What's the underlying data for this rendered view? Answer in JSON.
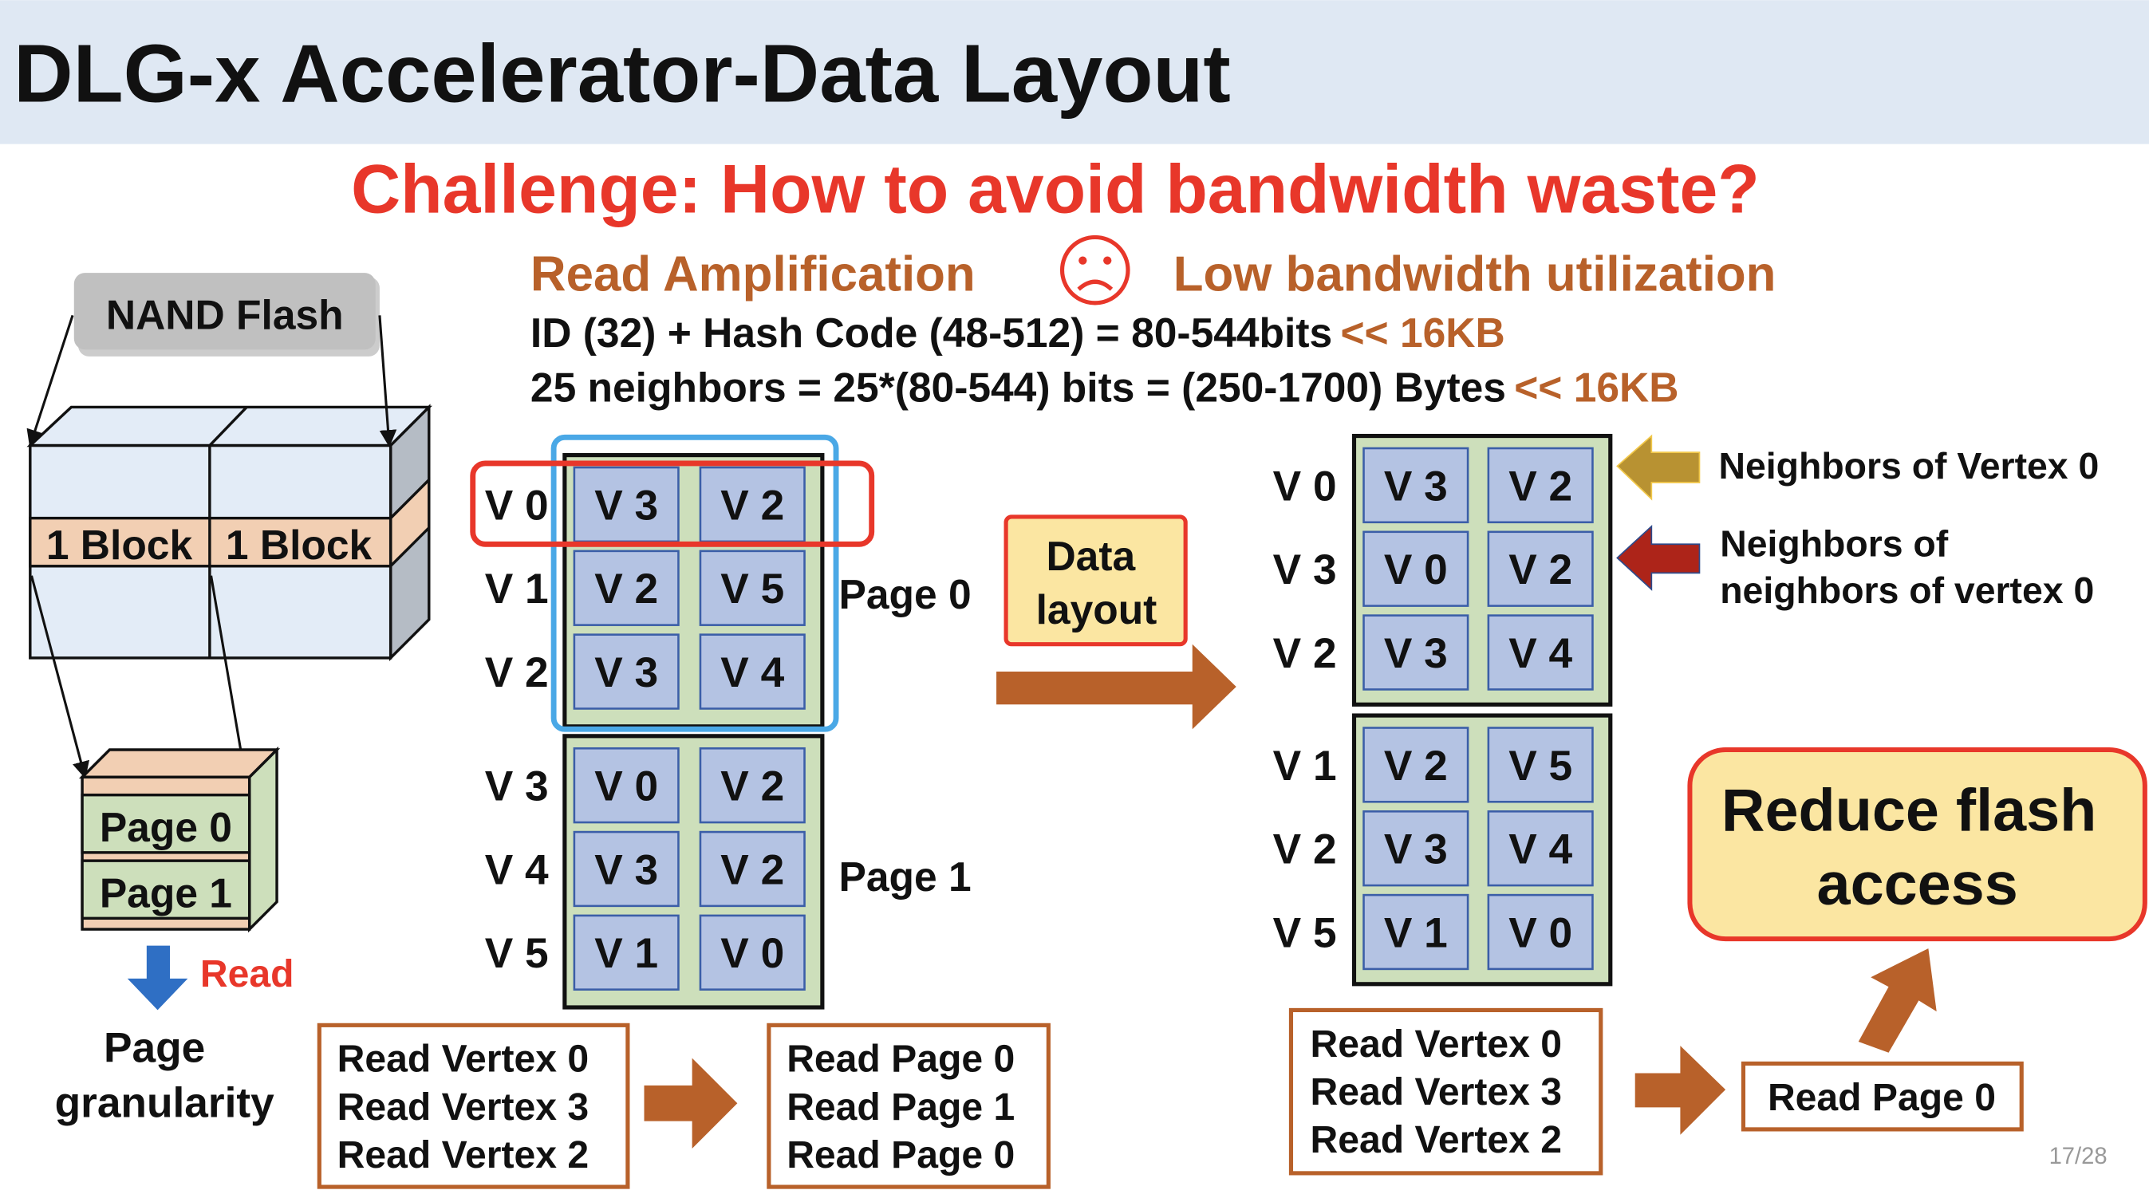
{
  "title": "DLG-x Accelerator-Data Layout",
  "challenge": "Challenge: How to avoid bandwidth waste?",
  "problem": {
    "read_amplification": "Read Amplification",
    "sad_face_icon": "sad-face",
    "low_bandwidth": "Low bandwidth utilization",
    "line1": "ID (32) + Hash Code (48-512) = 80-544bits",
    "line1_cmp": "<< 16KB",
    "line2": "25 neighbors = 25*(80-544) bits = (250-1700) Bytes",
    "line2_cmp": "<< 16KB"
  },
  "nand": {
    "label": "NAND Flash",
    "block1": "1 Block",
    "block2": "1 Block",
    "page0": "Page 0",
    "page1": "Page 1",
    "read": "Read",
    "granularity_line1": "Page",
    "granularity_line2": "granularity"
  },
  "before_layout": {
    "pages": [
      {
        "label": "Page 0",
        "rows": [
          {
            "vertex": "V 0",
            "neighbors": [
              "V 3",
              "V 2"
            ]
          },
          {
            "vertex": "V 1",
            "neighbors": [
              "V 2",
              "V 5"
            ]
          },
          {
            "vertex": "V 2",
            "neighbors": [
              "V 3",
              "V 4"
            ]
          }
        ]
      },
      {
        "label": "Page 1",
        "rows": [
          {
            "vertex": "V 3",
            "neighbors": [
              "V 0",
              "V 2"
            ]
          },
          {
            "vertex": "V 4",
            "neighbors": [
              "V 3",
              "V 2"
            ]
          },
          {
            "vertex": "V 5",
            "neighbors": [
              "V 1",
              "V 0"
            ]
          }
        ]
      }
    ],
    "requests": [
      "Read Vertex 0",
      "Read Vertex 3",
      "Read Vertex 2"
    ],
    "page_reads": [
      "Read Page 0",
      "Read Page 1",
      "Read Page 0"
    ]
  },
  "data_layout_label": [
    "Data",
    "layout"
  ],
  "after_layout": {
    "pages": [
      {
        "rows": [
          {
            "vertex": "V 0",
            "neighbors": [
              "V 3",
              "V 2"
            ]
          },
          {
            "vertex": "V 3",
            "neighbors": [
              "V 0",
              "V 2"
            ]
          },
          {
            "vertex": "V 2",
            "neighbors": [
              "V 3",
              "V 4"
            ]
          }
        ]
      },
      {
        "rows": [
          {
            "vertex": "V 1",
            "neighbors": [
              "V 2",
              "V 5"
            ]
          },
          {
            "vertex": "V 2",
            "neighbors": [
              "V 3",
              "V 4"
            ]
          },
          {
            "vertex": "V 5",
            "neighbors": [
              "V 1",
              "V 0"
            ]
          }
        ]
      }
    ],
    "annotation_vertex0": "Neighbors of Vertex 0",
    "annotation_nn_line1": "Neighbors of",
    "annotation_nn_line2": "neighbors of vertex 0",
    "requests": [
      "Read Vertex 0",
      "Read Vertex 3",
      "Read Vertex 2"
    ],
    "page_reads": [
      "Read Page 0"
    ]
  },
  "result": [
    "Reduce flash",
    "access"
  ],
  "slide_number": "17/28",
  "colors": {
    "header_bg": "#dfe8f3",
    "challenge_red": "#e8372a",
    "brown": "#b8612a",
    "page_green": "#cddfbb",
    "cell_blue": "#b4c3e3",
    "highlight_blue": "#4aa8e6",
    "yellow": "#fbe6a2",
    "gold_arrow": "#b89232",
    "red_arrow": "#ad2419"
  }
}
